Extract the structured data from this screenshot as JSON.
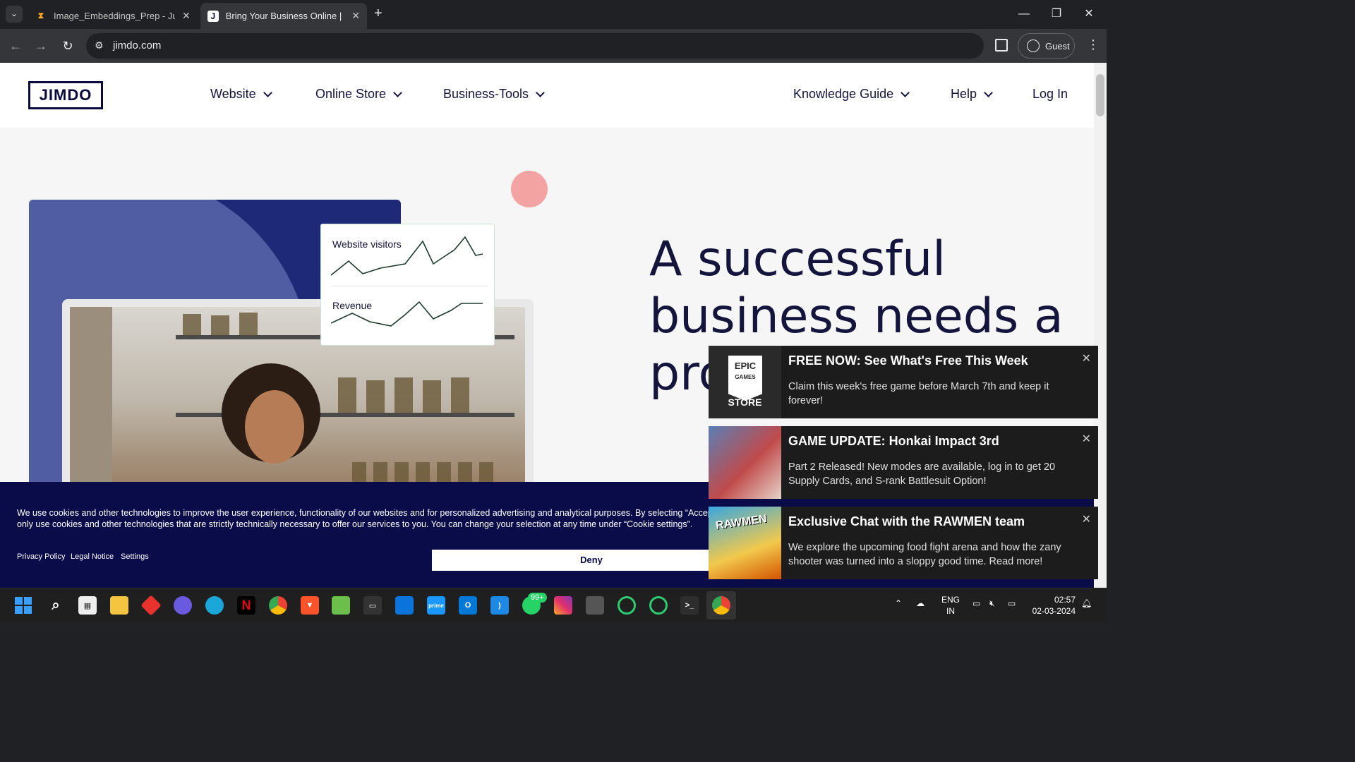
{
  "browser": {
    "tabs": [
      {
        "title": "Image_Embeddings_Prep - Jupy",
        "active": false,
        "icon": "hourglass-icon"
      },
      {
        "title": "Bring Your Business Online | We",
        "active": true,
        "icon": "jimdo-icon"
      }
    ],
    "url": "jimdo.com",
    "profile_label": "Guest"
  },
  "site": {
    "logo": "JIMDO",
    "nav_left": [
      "Website",
      "Online Store",
      "Business-Tools"
    ],
    "nav_right": [
      "Knowledge Guide",
      "Help"
    ],
    "login": "Log In",
    "hero_title": "A successful business needs a pro website",
    "stat_labels": {
      "visitors": "Website visitors",
      "revenue": "Revenue"
    }
  },
  "cookie": {
    "text_line1": "We use cookies and other technologies to improve the user experience, functionality of our websites and for personalized advertising and analytical purposes. By selecting “Accept All",
    "text_line2": "only use cookies and other technologies that are strictly technically necessary to offer our services to you. You can change your selection at any time under “Cookie settings”.",
    "links": [
      "Privacy Policy",
      "Legal Notice",
      "Settings"
    ],
    "deny": "Deny"
  },
  "notifications": [
    {
      "title": "FREE NOW: See What's Free This Week",
      "body": "Claim this week's free game before March 7th and keep it forever!",
      "thumb_text": "EPIC GAMES STORE"
    },
    {
      "title": "GAME UPDATE: Honkai Impact 3rd",
      "body": "Part 2 Released! New modes are available, log in to get 20 Supply Cards, and S-rank Battlesuit Option!"
    },
    {
      "title": "Exclusive Chat with the RAWMEN team",
      "body": "We explore the upcoming food fight arena and how the zany shooter was turned into a sloppy good time. Read more!",
      "thumb_text": "RAWMEN"
    }
  ],
  "taskbar": {
    "whatsapp_badge": "99+",
    "lang_line1": "ENG",
    "lang_line2": "IN",
    "time": "02:57",
    "date": "02-03-2024"
  }
}
